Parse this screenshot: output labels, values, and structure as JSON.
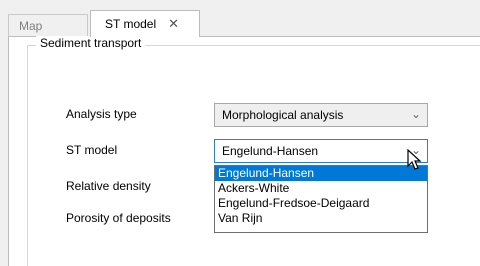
{
  "tabs": [
    {
      "label": "Map"
    },
    {
      "label": "ST model",
      "close_glyph": "✕"
    }
  ],
  "group": {
    "title": "Sediment transport"
  },
  "fields": {
    "analysis_type": {
      "label": "Analysis type",
      "value": "Morphological analysis"
    },
    "st_model": {
      "label": "ST model",
      "value": "Engelund-Hansen"
    },
    "relative_density": {
      "label": "Relative density"
    },
    "porosity": {
      "label": "Porosity of deposits"
    }
  },
  "dropdown": {
    "options": [
      "Engelund-Hansen",
      "Ackers-White",
      "Engelund-Fredsoe-Deigaard",
      "Van Rijn"
    ],
    "selected_index": 0
  },
  "icons": {
    "chevron": "chevron-down-icon",
    "close": "close-icon",
    "cursor": "mouse-pointer-icon"
  },
  "colors": {
    "selection": "#0078d7",
    "focus_border": "#2f7fd0"
  }
}
